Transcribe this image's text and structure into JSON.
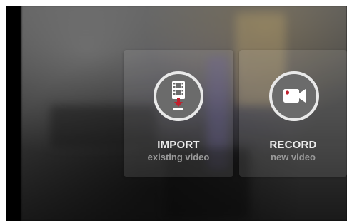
{
  "import_option": {
    "title": "IMPORT",
    "subtitle": "existing video",
    "icon": "film-import-icon"
  },
  "record_option": {
    "title": "RECORD",
    "subtitle": "new video",
    "icon": "video-camera-icon"
  },
  "colors": {
    "icon_circle_fill": "#6b6b6b",
    "icon_circle_border": "#e9e9e9",
    "accent_red": "#c0202e",
    "title_text": "#ececec",
    "subtitle_text": "#9a9a9a"
  }
}
